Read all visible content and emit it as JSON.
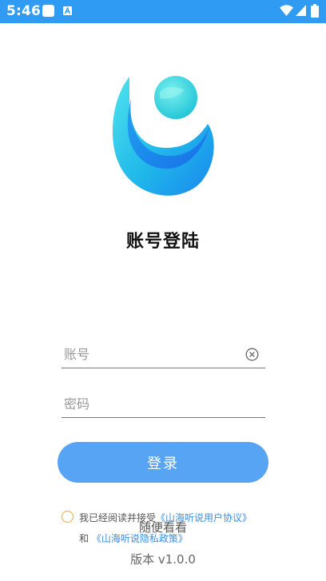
{
  "status_bar": {
    "time": "5:46",
    "icons": [
      "notification-icon",
      "a-icon",
      "wifi-icon",
      "signal-icon",
      "battery-icon"
    ]
  },
  "logo": {
    "icon": "app-logo-icon",
    "colors": [
      "#1fc7e6",
      "#1a7ff0",
      "#4fe0e3"
    ]
  },
  "title": "账号登陆",
  "form": {
    "account_placeholder": "账号",
    "account_value": "",
    "password_placeholder": "密码",
    "password_value": "",
    "clear_icon": "clear-circle-x-icon"
  },
  "login_button": "登录",
  "agreement": {
    "prefix": "我已经阅读并接受",
    "user_agreement": "《山海听说用户协议》",
    "and": "和",
    "privacy_policy": "《山海听说隐私政策》"
  },
  "browse_link": "随便看看",
  "version": "版本 v1.0.0",
  "colors": {
    "status_bar": "#2f9bf2",
    "button": "#58a4f4",
    "link": "#3b8ddf",
    "checkbox": "#f0a83a"
  }
}
